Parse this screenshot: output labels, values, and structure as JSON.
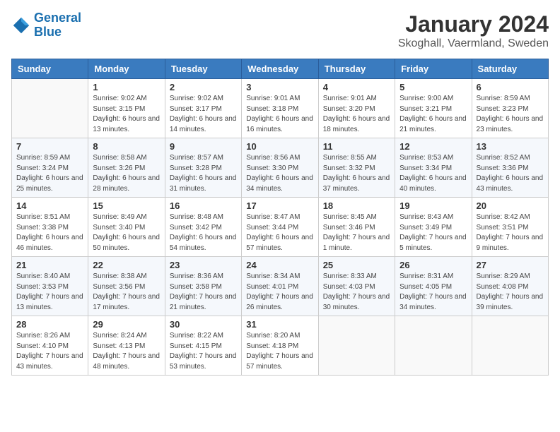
{
  "header": {
    "logo_line1": "General",
    "logo_line2": "Blue",
    "month": "January 2024",
    "location": "Skoghall, Vaermland, Sweden"
  },
  "days_of_week": [
    "Sunday",
    "Monday",
    "Tuesday",
    "Wednesday",
    "Thursday",
    "Friday",
    "Saturday"
  ],
  "weeks": [
    [
      {
        "day": "",
        "sunrise": "",
        "sunset": "",
        "daylight": ""
      },
      {
        "day": "1",
        "sunrise": "Sunrise: 9:02 AM",
        "sunset": "Sunset: 3:15 PM",
        "daylight": "Daylight: 6 hours and 13 minutes."
      },
      {
        "day": "2",
        "sunrise": "Sunrise: 9:02 AM",
        "sunset": "Sunset: 3:17 PM",
        "daylight": "Daylight: 6 hours and 14 minutes."
      },
      {
        "day": "3",
        "sunrise": "Sunrise: 9:01 AM",
        "sunset": "Sunset: 3:18 PM",
        "daylight": "Daylight: 6 hours and 16 minutes."
      },
      {
        "day": "4",
        "sunrise": "Sunrise: 9:01 AM",
        "sunset": "Sunset: 3:20 PM",
        "daylight": "Daylight: 6 hours and 18 minutes."
      },
      {
        "day": "5",
        "sunrise": "Sunrise: 9:00 AM",
        "sunset": "Sunset: 3:21 PM",
        "daylight": "Daylight: 6 hours and 21 minutes."
      },
      {
        "day": "6",
        "sunrise": "Sunrise: 8:59 AM",
        "sunset": "Sunset: 3:23 PM",
        "daylight": "Daylight: 6 hours and 23 minutes."
      }
    ],
    [
      {
        "day": "7",
        "sunrise": "Sunrise: 8:59 AM",
        "sunset": "Sunset: 3:24 PM",
        "daylight": "Daylight: 6 hours and 25 minutes."
      },
      {
        "day": "8",
        "sunrise": "Sunrise: 8:58 AM",
        "sunset": "Sunset: 3:26 PM",
        "daylight": "Daylight: 6 hours and 28 minutes."
      },
      {
        "day": "9",
        "sunrise": "Sunrise: 8:57 AM",
        "sunset": "Sunset: 3:28 PM",
        "daylight": "Daylight: 6 hours and 31 minutes."
      },
      {
        "day": "10",
        "sunrise": "Sunrise: 8:56 AM",
        "sunset": "Sunset: 3:30 PM",
        "daylight": "Daylight: 6 hours and 34 minutes."
      },
      {
        "day": "11",
        "sunrise": "Sunrise: 8:55 AM",
        "sunset": "Sunset: 3:32 PM",
        "daylight": "Daylight: 6 hours and 37 minutes."
      },
      {
        "day": "12",
        "sunrise": "Sunrise: 8:53 AM",
        "sunset": "Sunset: 3:34 PM",
        "daylight": "Daylight: 6 hours and 40 minutes."
      },
      {
        "day": "13",
        "sunrise": "Sunrise: 8:52 AM",
        "sunset": "Sunset: 3:36 PM",
        "daylight": "Daylight: 6 hours and 43 minutes."
      }
    ],
    [
      {
        "day": "14",
        "sunrise": "Sunrise: 8:51 AM",
        "sunset": "Sunset: 3:38 PM",
        "daylight": "Daylight: 6 hours and 46 minutes."
      },
      {
        "day": "15",
        "sunrise": "Sunrise: 8:49 AM",
        "sunset": "Sunset: 3:40 PM",
        "daylight": "Daylight: 6 hours and 50 minutes."
      },
      {
        "day": "16",
        "sunrise": "Sunrise: 8:48 AM",
        "sunset": "Sunset: 3:42 PM",
        "daylight": "Daylight: 6 hours and 54 minutes."
      },
      {
        "day": "17",
        "sunrise": "Sunrise: 8:47 AM",
        "sunset": "Sunset: 3:44 PM",
        "daylight": "Daylight: 6 hours and 57 minutes."
      },
      {
        "day": "18",
        "sunrise": "Sunrise: 8:45 AM",
        "sunset": "Sunset: 3:46 PM",
        "daylight": "Daylight: 7 hours and 1 minute."
      },
      {
        "day": "19",
        "sunrise": "Sunrise: 8:43 AM",
        "sunset": "Sunset: 3:49 PM",
        "daylight": "Daylight: 7 hours and 5 minutes."
      },
      {
        "day": "20",
        "sunrise": "Sunrise: 8:42 AM",
        "sunset": "Sunset: 3:51 PM",
        "daylight": "Daylight: 7 hours and 9 minutes."
      }
    ],
    [
      {
        "day": "21",
        "sunrise": "Sunrise: 8:40 AM",
        "sunset": "Sunset: 3:53 PM",
        "daylight": "Daylight: 7 hours and 13 minutes."
      },
      {
        "day": "22",
        "sunrise": "Sunrise: 8:38 AM",
        "sunset": "Sunset: 3:56 PM",
        "daylight": "Daylight: 7 hours and 17 minutes."
      },
      {
        "day": "23",
        "sunrise": "Sunrise: 8:36 AM",
        "sunset": "Sunset: 3:58 PM",
        "daylight": "Daylight: 7 hours and 21 minutes."
      },
      {
        "day": "24",
        "sunrise": "Sunrise: 8:34 AM",
        "sunset": "Sunset: 4:01 PM",
        "daylight": "Daylight: 7 hours and 26 minutes."
      },
      {
        "day": "25",
        "sunrise": "Sunrise: 8:33 AM",
        "sunset": "Sunset: 4:03 PM",
        "daylight": "Daylight: 7 hours and 30 minutes."
      },
      {
        "day": "26",
        "sunrise": "Sunrise: 8:31 AM",
        "sunset": "Sunset: 4:05 PM",
        "daylight": "Daylight: 7 hours and 34 minutes."
      },
      {
        "day": "27",
        "sunrise": "Sunrise: 8:29 AM",
        "sunset": "Sunset: 4:08 PM",
        "daylight": "Daylight: 7 hours and 39 minutes."
      }
    ],
    [
      {
        "day": "28",
        "sunrise": "Sunrise: 8:26 AM",
        "sunset": "Sunset: 4:10 PM",
        "daylight": "Daylight: 7 hours and 43 minutes."
      },
      {
        "day": "29",
        "sunrise": "Sunrise: 8:24 AM",
        "sunset": "Sunset: 4:13 PM",
        "daylight": "Daylight: 7 hours and 48 minutes."
      },
      {
        "day": "30",
        "sunrise": "Sunrise: 8:22 AM",
        "sunset": "Sunset: 4:15 PM",
        "daylight": "Daylight: 7 hours and 53 minutes."
      },
      {
        "day": "31",
        "sunrise": "Sunrise: 8:20 AM",
        "sunset": "Sunset: 4:18 PM",
        "daylight": "Daylight: 7 hours and 57 minutes."
      },
      {
        "day": "",
        "sunrise": "",
        "sunset": "",
        "daylight": ""
      },
      {
        "day": "",
        "sunrise": "",
        "sunset": "",
        "daylight": ""
      },
      {
        "day": "",
        "sunrise": "",
        "sunset": "",
        "daylight": ""
      }
    ]
  ]
}
